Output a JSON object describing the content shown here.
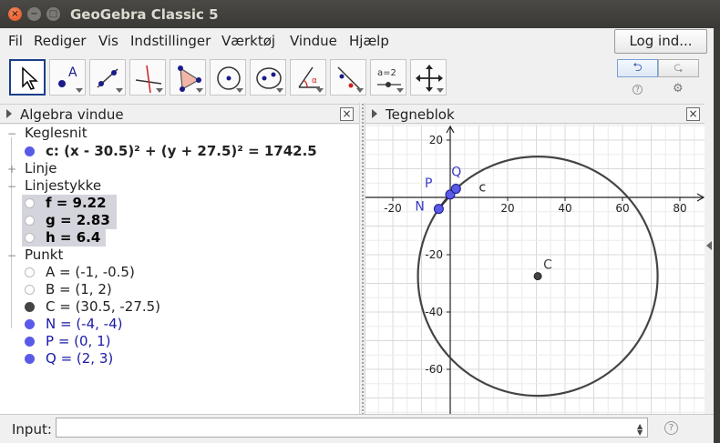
{
  "window": {
    "title": "GeoGebra Classic 5",
    "close_glyph": "×",
    "min_glyph": "−",
    "max_glyph": "□"
  },
  "menu": {
    "items": [
      "Fil",
      "Rediger",
      "Vis",
      "Indstillinger",
      "Værktøj",
      "Vindue",
      "Hjælp"
    ],
    "login_label": "Log ind..."
  },
  "toolbar": {
    "tools": [
      {
        "icon": "move-arrow-icon",
        "selected": true
      },
      {
        "icon": "new-point-icon",
        "label": "A"
      },
      {
        "icon": "line-icon"
      },
      {
        "icon": "perpendicular-line-icon"
      },
      {
        "icon": "polygon-icon"
      },
      {
        "icon": "circle-center-point-icon"
      },
      {
        "icon": "ellipse-icon"
      },
      {
        "icon": "angle-icon",
        "label": "α"
      },
      {
        "icon": "reflect-icon"
      },
      {
        "icon": "slider-icon",
        "label": "a=2"
      },
      {
        "icon": "move-graphics-view-icon"
      }
    ],
    "undo_glyph": "⮌",
    "redo_glyph": "⮎",
    "help_glyph": "?",
    "settings_glyph": "⚙"
  },
  "algebra": {
    "title": "Algebra vindue",
    "close_glyph": "×",
    "groups": [
      {
        "name": "Keglesnit",
        "expanded": true,
        "items": [
          {
            "text": "c: (x - 30.5)² + (y + 27.5)² = 1742.5",
            "dot": "filled",
            "color": "#222222",
            "bold": true
          }
        ]
      },
      {
        "name": "Linje",
        "expanded": false,
        "items": []
      },
      {
        "name": "Linjestykke",
        "expanded": true,
        "items": [
          {
            "text": "f = 9.22",
            "dot": "hidden",
            "color": "#222222",
            "bold": true
          },
          {
            "text": "g = 2.83",
            "dot": "hidden",
            "color": "#222222",
            "bold": true
          },
          {
            "text": "h = 6.4",
            "dot": "hidden",
            "color": "#222222",
            "bold": true
          }
        ]
      },
      {
        "name": "Punkt",
        "expanded": true,
        "items": [
          {
            "text": "A = (-1, -0.5)",
            "dot": "hidden",
            "color": "#222222",
            "bold": false
          },
          {
            "text": "B = (1, 2)",
            "dot": "hidden",
            "color": "#222222",
            "bold": false
          },
          {
            "text": "C = (30.5, -27.5)",
            "dot": "filled",
            "color": "#222222",
            "bold": false
          },
          {
            "text": "N = (-4, -4)",
            "dot": "filled",
            "color": "#1a1aa8",
            "bold": false
          },
          {
            "text": "P = (0, 1)",
            "dot": "filled",
            "color": "#1a1aa8",
            "bold": false
          },
          {
            "text": "Q = (2, 3)",
            "dot": "filled",
            "color": "#1a1aa8",
            "bold": false
          }
        ]
      }
    ]
  },
  "graphics": {
    "title": "Tegneblok",
    "close_glyph": "×",
    "x_ticks": [
      "-20",
      "20",
      "40",
      "60",
      "80"
    ],
    "y_ticks": [
      "20",
      "-20",
      "-40",
      "-60"
    ],
    "circle_label": "c",
    "center_label": "C",
    "point_labels": {
      "N": "N",
      "P": "P",
      "Q": "Q"
    }
  },
  "input": {
    "label": "Input:",
    "value": "",
    "help_glyph": "?"
  },
  "colors": {
    "accent": "#1a3f8a",
    "point_blue": "#5a5ae8",
    "point_dark": "#444444",
    "grid": "#e6e6e6"
  }
}
